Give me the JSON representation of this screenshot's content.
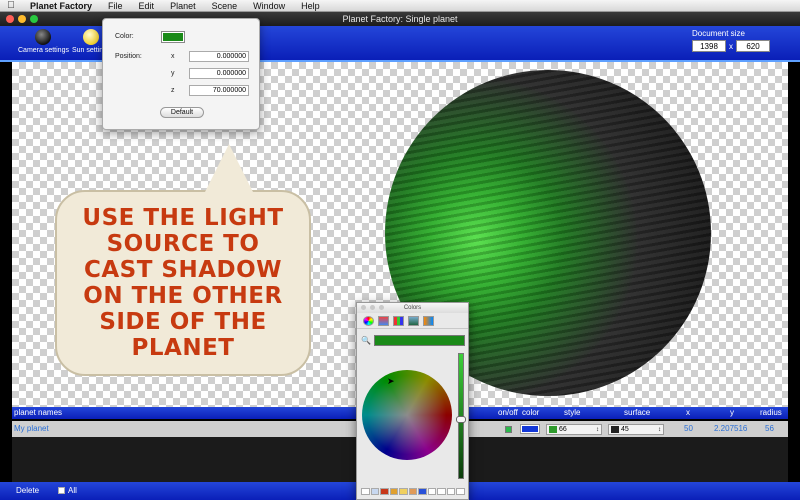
{
  "menubar": {
    "app_name": "Planet Factory",
    "items": [
      "File",
      "Edit",
      "Planet",
      "Scene",
      "Window",
      "Help"
    ]
  },
  "window": {
    "title": "Planet Factory: Single planet"
  },
  "toolbar": {
    "camera_label": "Camera settings",
    "sun_label": "Sun settings",
    "doc_size_label": "Document size",
    "doc_width": "1398",
    "doc_height": "620",
    "doc_separator": "x"
  },
  "sun_popover": {
    "color_label": "Color:",
    "position_label": "Position:",
    "x_label": "x",
    "y_label": "y",
    "z_label": "z",
    "x_value": "0.000000",
    "y_value": "0.000000",
    "z_value": "70.000000",
    "default_button": "Default",
    "color_value": "#1a8a18"
  },
  "bubble": {
    "text": "USE THE LIGHT SOURCE TO CAST SHADOW ON THE OTHER SIDE OF THE PLANET"
  },
  "table": {
    "headers": {
      "name": "planet names",
      "onoff": "on/off",
      "color": "color",
      "style": "style",
      "surface": "surface",
      "x": "x",
      "y": "y",
      "radius": "radius"
    },
    "row": {
      "name": "My planet",
      "style": "66",
      "surface": "45",
      "x": "50",
      "y": "2.207516",
      "radius": "56",
      "color": "#1338d8"
    }
  },
  "footer": {
    "delete_label": "Delete",
    "all_label": "All"
  },
  "colors_panel": {
    "title": "Colors",
    "current_color": "#1a8a18",
    "palette": [
      "#ffffff",
      "#c8d8f0",
      "#c8381a",
      "#e0a030",
      "#f0d060",
      "#e09a58",
      "#2850d8",
      "#ffffff",
      "#ffffff",
      "#ffffff",
      "#ffffff"
    ]
  },
  "icons": {
    "apple": "apple-icon",
    "camera": "camera-icon",
    "sun": "sun-icon",
    "search": "magnifier-icon",
    "color_wheel": "color-wheel-icon"
  },
  "colors": {
    "toolbar_blue": "#0a1fb8",
    "planet_green": "#2fae2c",
    "bubble_text": "#c73a10",
    "bubble_bg": "#f1ead8"
  }
}
